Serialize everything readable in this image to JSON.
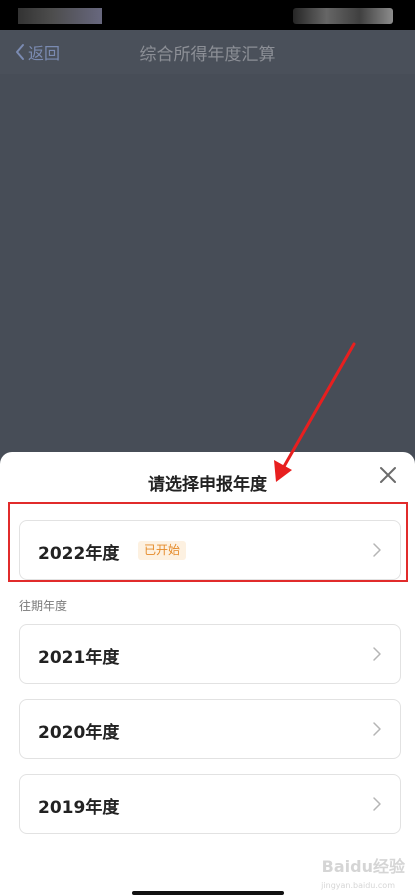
{
  "nav": {
    "back_label": "返回",
    "title": "综合所得年度汇算"
  },
  "sheet": {
    "title": "请选择申报年度",
    "current": {
      "year_label": "2022年度",
      "badge": "已开始"
    },
    "past_section_label": "往期年度",
    "past_years": [
      {
        "label": "2021年度"
      },
      {
        "label": "2020年度"
      },
      {
        "label": "2019年度"
      }
    ]
  },
  "watermark": {
    "text": "Baidu经验",
    "sub": "jingyan.baidu.com"
  },
  "icons": {
    "back": "chevron-left-icon",
    "close": "close-icon",
    "row_chevron": "chevron-right-icon"
  },
  "colors": {
    "overlay": "#474d57",
    "highlight": "#e12b2b",
    "badge_text": "#e58b2a",
    "badge_bg": "#fdf1e1"
  }
}
